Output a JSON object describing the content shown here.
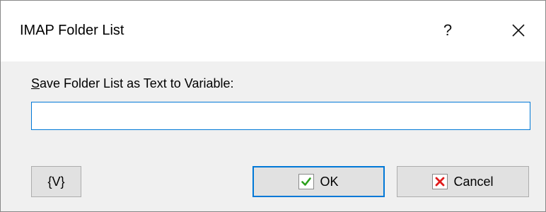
{
  "window": {
    "title": "IMAP Folder List",
    "help_label": "?"
  },
  "form": {
    "label_accel": "S",
    "label_rest": "ave Folder List as Text to Variable:",
    "value": "",
    "placeholder": ""
  },
  "buttons": {
    "variable_label": "{V}",
    "ok_label": "OK",
    "cancel_label": "Cancel"
  },
  "icons": {
    "ok": "check-icon",
    "cancel": "cross-icon",
    "close": "close-icon"
  },
  "colors": {
    "accent": "#0078d7",
    "check": "#2ca01c",
    "cross": "#e01b1b"
  }
}
